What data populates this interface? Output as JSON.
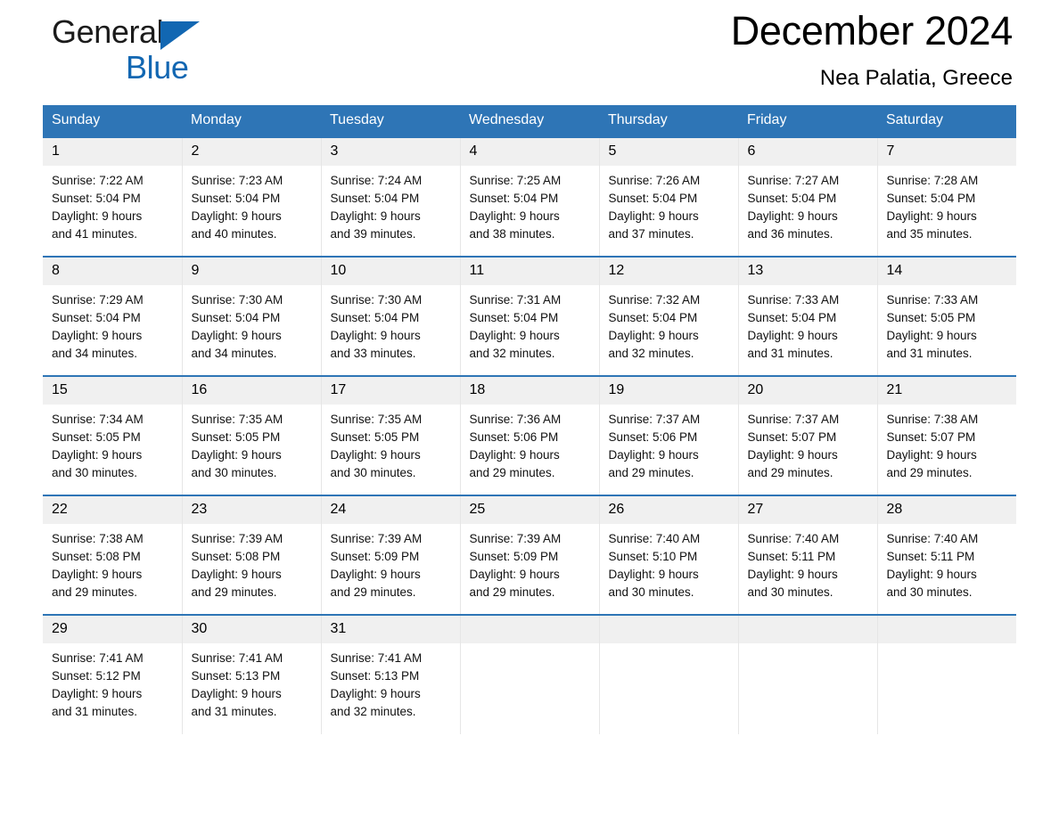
{
  "logo": {
    "word1": "General",
    "word2": "Blue",
    "triangle_color": "#1267b2"
  },
  "header": {
    "month_title": "December 2024",
    "location": "Nea Palatia, Greece",
    "accent_color": "#2e75b6",
    "daynum_band_color": "#f0f0f0"
  },
  "calendar": {
    "weekday_headers": [
      "Sunday",
      "Monday",
      "Tuesday",
      "Wednesday",
      "Thursday",
      "Friday",
      "Saturday"
    ],
    "weeks": [
      [
        {
          "day": "1",
          "sunrise": "Sunrise: 7:22 AM",
          "sunset": "Sunset: 5:04 PM",
          "daylight_line1": "Daylight: 9 hours",
          "daylight_line2": "and 41 minutes."
        },
        {
          "day": "2",
          "sunrise": "Sunrise: 7:23 AM",
          "sunset": "Sunset: 5:04 PM",
          "daylight_line1": "Daylight: 9 hours",
          "daylight_line2": "and 40 minutes."
        },
        {
          "day": "3",
          "sunrise": "Sunrise: 7:24 AM",
          "sunset": "Sunset: 5:04 PM",
          "daylight_line1": "Daylight: 9 hours",
          "daylight_line2": "and 39 minutes."
        },
        {
          "day": "4",
          "sunrise": "Sunrise: 7:25 AM",
          "sunset": "Sunset: 5:04 PM",
          "daylight_line1": "Daylight: 9 hours",
          "daylight_line2": "and 38 minutes."
        },
        {
          "day": "5",
          "sunrise": "Sunrise: 7:26 AM",
          "sunset": "Sunset: 5:04 PM",
          "daylight_line1": "Daylight: 9 hours",
          "daylight_line2": "and 37 minutes."
        },
        {
          "day": "6",
          "sunrise": "Sunrise: 7:27 AM",
          "sunset": "Sunset: 5:04 PM",
          "daylight_line1": "Daylight: 9 hours",
          "daylight_line2": "and 36 minutes."
        },
        {
          "day": "7",
          "sunrise": "Sunrise: 7:28 AM",
          "sunset": "Sunset: 5:04 PM",
          "daylight_line1": "Daylight: 9 hours",
          "daylight_line2": "and 35 minutes."
        }
      ],
      [
        {
          "day": "8",
          "sunrise": "Sunrise: 7:29 AM",
          "sunset": "Sunset: 5:04 PM",
          "daylight_line1": "Daylight: 9 hours",
          "daylight_line2": "and 34 minutes."
        },
        {
          "day": "9",
          "sunrise": "Sunrise: 7:30 AM",
          "sunset": "Sunset: 5:04 PM",
          "daylight_line1": "Daylight: 9 hours",
          "daylight_line2": "and 34 minutes."
        },
        {
          "day": "10",
          "sunrise": "Sunrise: 7:30 AM",
          "sunset": "Sunset: 5:04 PM",
          "daylight_line1": "Daylight: 9 hours",
          "daylight_line2": "and 33 minutes."
        },
        {
          "day": "11",
          "sunrise": "Sunrise: 7:31 AM",
          "sunset": "Sunset: 5:04 PM",
          "daylight_line1": "Daylight: 9 hours",
          "daylight_line2": "and 32 minutes."
        },
        {
          "day": "12",
          "sunrise": "Sunrise: 7:32 AM",
          "sunset": "Sunset: 5:04 PM",
          "daylight_line1": "Daylight: 9 hours",
          "daylight_line2": "and 32 minutes."
        },
        {
          "day": "13",
          "sunrise": "Sunrise: 7:33 AM",
          "sunset": "Sunset: 5:04 PM",
          "daylight_line1": "Daylight: 9 hours",
          "daylight_line2": "and 31 minutes."
        },
        {
          "day": "14",
          "sunrise": "Sunrise: 7:33 AM",
          "sunset": "Sunset: 5:05 PM",
          "daylight_line1": "Daylight: 9 hours",
          "daylight_line2": "and 31 minutes."
        }
      ],
      [
        {
          "day": "15",
          "sunrise": "Sunrise: 7:34 AM",
          "sunset": "Sunset: 5:05 PM",
          "daylight_line1": "Daylight: 9 hours",
          "daylight_line2": "and 30 minutes."
        },
        {
          "day": "16",
          "sunrise": "Sunrise: 7:35 AM",
          "sunset": "Sunset: 5:05 PM",
          "daylight_line1": "Daylight: 9 hours",
          "daylight_line2": "and 30 minutes."
        },
        {
          "day": "17",
          "sunrise": "Sunrise: 7:35 AM",
          "sunset": "Sunset: 5:05 PM",
          "daylight_line1": "Daylight: 9 hours",
          "daylight_line2": "and 30 minutes."
        },
        {
          "day": "18",
          "sunrise": "Sunrise: 7:36 AM",
          "sunset": "Sunset: 5:06 PM",
          "daylight_line1": "Daylight: 9 hours",
          "daylight_line2": "and 29 minutes."
        },
        {
          "day": "19",
          "sunrise": "Sunrise: 7:37 AM",
          "sunset": "Sunset: 5:06 PM",
          "daylight_line1": "Daylight: 9 hours",
          "daylight_line2": "and 29 minutes."
        },
        {
          "day": "20",
          "sunrise": "Sunrise: 7:37 AM",
          "sunset": "Sunset: 5:07 PM",
          "daylight_line1": "Daylight: 9 hours",
          "daylight_line2": "and 29 minutes."
        },
        {
          "day": "21",
          "sunrise": "Sunrise: 7:38 AM",
          "sunset": "Sunset: 5:07 PM",
          "daylight_line1": "Daylight: 9 hours",
          "daylight_line2": "and 29 minutes."
        }
      ],
      [
        {
          "day": "22",
          "sunrise": "Sunrise: 7:38 AM",
          "sunset": "Sunset: 5:08 PM",
          "daylight_line1": "Daylight: 9 hours",
          "daylight_line2": "and 29 minutes."
        },
        {
          "day": "23",
          "sunrise": "Sunrise: 7:39 AM",
          "sunset": "Sunset: 5:08 PM",
          "daylight_line1": "Daylight: 9 hours",
          "daylight_line2": "and 29 minutes."
        },
        {
          "day": "24",
          "sunrise": "Sunrise: 7:39 AM",
          "sunset": "Sunset: 5:09 PM",
          "daylight_line1": "Daylight: 9 hours",
          "daylight_line2": "and 29 minutes."
        },
        {
          "day": "25",
          "sunrise": "Sunrise: 7:39 AM",
          "sunset": "Sunset: 5:09 PM",
          "daylight_line1": "Daylight: 9 hours",
          "daylight_line2": "and 29 minutes."
        },
        {
          "day": "26",
          "sunrise": "Sunrise: 7:40 AM",
          "sunset": "Sunset: 5:10 PM",
          "daylight_line1": "Daylight: 9 hours",
          "daylight_line2": "and 30 minutes."
        },
        {
          "day": "27",
          "sunrise": "Sunrise: 7:40 AM",
          "sunset": "Sunset: 5:11 PM",
          "daylight_line1": "Daylight: 9 hours",
          "daylight_line2": "and 30 minutes."
        },
        {
          "day": "28",
          "sunrise": "Sunrise: 7:40 AM",
          "sunset": "Sunset: 5:11 PM",
          "daylight_line1": "Daylight: 9 hours",
          "daylight_line2": "and 30 minutes."
        }
      ],
      [
        {
          "day": "29",
          "sunrise": "Sunrise: 7:41 AM",
          "sunset": "Sunset: 5:12 PM",
          "daylight_line1": "Daylight: 9 hours",
          "daylight_line2": "and 31 minutes."
        },
        {
          "day": "30",
          "sunrise": "Sunrise: 7:41 AM",
          "sunset": "Sunset: 5:13 PM",
          "daylight_line1": "Daylight: 9 hours",
          "daylight_line2": "and 31 minutes."
        },
        {
          "day": "31",
          "sunrise": "Sunrise: 7:41 AM",
          "sunset": "Sunset: 5:13 PM",
          "daylight_line1": "Daylight: 9 hours",
          "daylight_line2": "and 32 minutes."
        },
        {
          "day": "",
          "sunrise": "",
          "sunset": "",
          "daylight_line1": "",
          "daylight_line2": ""
        },
        {
          "day": "",
          "sunrise": "",
          "sunset": "",
          "daylight_line1": "",
          "daylight_line2": ""
        },
        {
          "day": "",
          "sunrise": "",
          "sunset": "",
          "daylight_line1": "",
          "daylight_line2": ""
        },
        {
          "day": "",
          "sunrise": "",
          "sunset": "",
          "daylight_line1": "",
          "daylight_line2": ""
        }
      ]
    ]
  }
}
